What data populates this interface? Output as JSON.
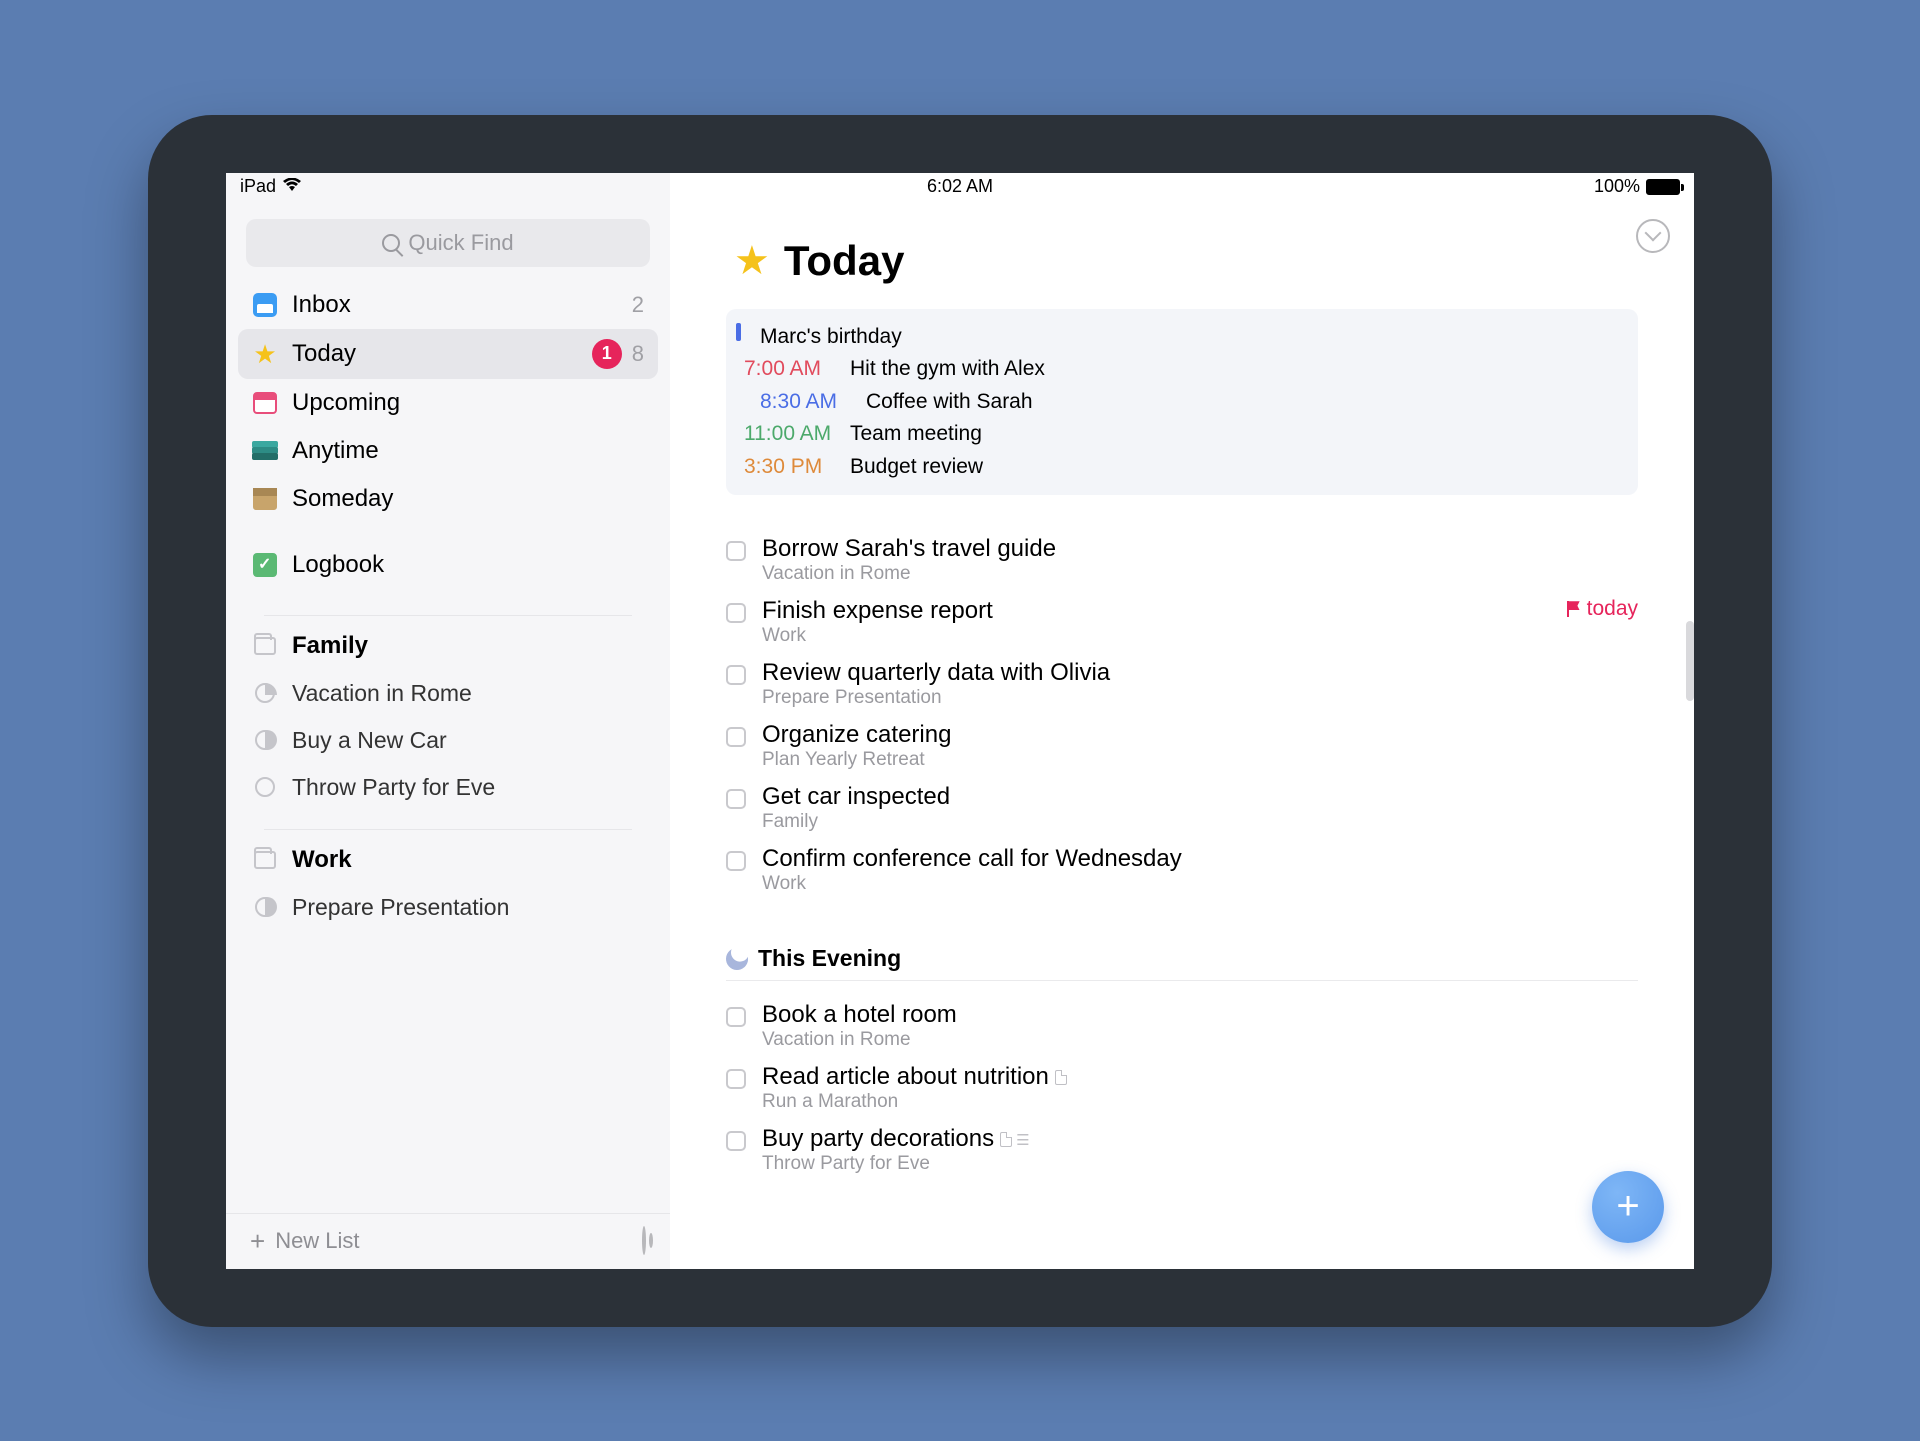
{
  "status": {
    "device": "iPad",
    "time": "6:02 AM",
    "battery": "100%"
  },
  "search": {
    "placeholder": "Quick Find"
  },
  "sidebar": {
    "main": [
      {
        "label": "Inbox",
        "count": "2"
      },
      {
        "label": "Today",
        "badge": "1",
        "count": "8"
      },
      {
        "label": "Upcoming"
      },
      {
        "label": "Anytime"
      },
      {
        "label": "Someday"
      },
      {
        "label": "Logbook"
      }
    ],
    "areas": [
      {
        "name": "Family",
        "projects": [
          {
            "name": "Vacation in Rome"
          },
          {
            "name": "Buy a New Car"
          },
          {
            "name": "Throw Party for Eve"
          }
        ]
      },
      {
        "name": "Work",
        "projects": [
          {
            "name": "Prepare Presentation"
          }
        ]
      }
    ],
    "footer": {
      "newList": "New List"
    }
  },
  "main": {
    "title": "Today",
    "calendar": {
      "allday": "Marc's birthday",
      "events": [
        {
          "time": "7:00 AM",
          "title": "Hit the gym with Alex",
          "color": "t-red"
        },
        {
          "time": "8:30 AM",
          "title": "Coffee with Sarah",
          "color": "t-blue"
        },
        {
          "time": "11:00 AM",
          "title": "Team meeting",
          "color": "t-green"
        },
        {
          "time": "3:30 PM",
          "title": "Budget review",
          "color": "t-orange"
        }
      ]
    },
    "tasks": [
      {
        "title": "Borrow Sarah's travel guide",
        "project": "Vacation in Rome"
      },
      {
        "title": "Finish expense report",
        "project": "Work",
        "deadline": "today"
      },
      {
        "title": "Review quarterly data with Olivia",
        "project": "Prepare Presentation"
      },
      {
        "title": "Organize catering",
        "project": "Plan Yearly Retreat"
      },
      {
        "title": "Get car inspected",
        "project": "Family"
      },
      {
        "title": "Confirm conference call for Wednesday",
        "project": "Work"
      }
    ],
    "evening": {
      "label": "This Evening",
      "tasks": [
        {
          "title": "Book a hotel room",
          "project": "Vacation in Rome"
        },
        {
          "title": "Read article about nutrition",
          "project": "Run a Marathon",
          "hasNote": true
        },
        {
          "title": "Buy party decorations",
          "project": "Throw Party for Eve",
          "hasNote": true,
          "hasChecklist": true
        }
      ]
    }
  }
}
